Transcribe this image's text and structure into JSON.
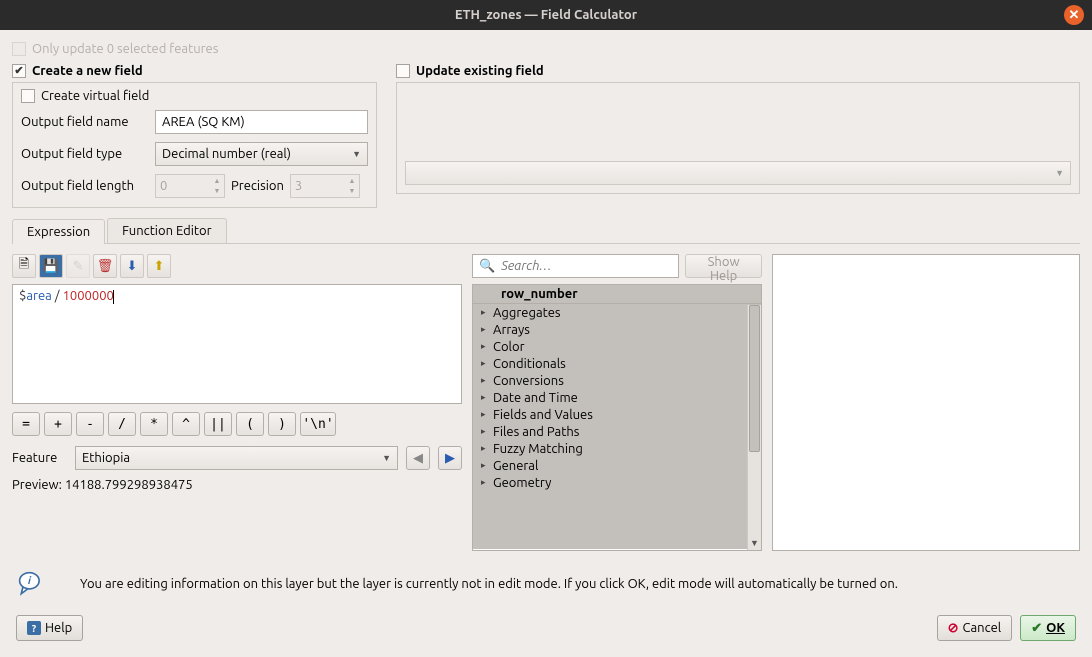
{
  "titlebar": {
    "title": "ETH_zones — Field Calculator"
  },
  "top": {
    "only_update_label": "Only update 0 selected features",
    "create_new_label": "Create a new field",
    "update_existing_label": "Update existing field",
    "create_virtual_label": "Create virtual field",
    "output_name_label": "Output field name",
    "output_name_value": "AREA (SQ KM)",
    "output_type_label": "Output field type",
    "output_type_value": "Decimal number (real)",
    "output_length_label": "Output field length",
    "output_length_value": "0",
    "precision_label": "Precision",
    "precision_value": "3"
  },
  "tabs": {
    "expression": "Expression",
    "function_editor": "Function Editor"
  },
  "toolbar_icons": {
    "new": "new-file-icon",
    "save": "save-icon",
    "edit": "edit-icon",
    "delete": "delete-icon",
    "import": "import-icon",
    "export": "export-icon"
  },
  "expression": {
    "prefix": "$",
    "var": "area",
    "op": " / ",
    "num": "1000000"
  },
  "operators": [
    "=",
    "+",
    "-",
    "/",
    "*",
    "^",
    "||",
    "(",
    ")",
    "'\\n'"
  ],
  "feature": {
    "label": "Feature",
    "value": "Ethiopia"
  },
  "preview": {
    "label": "Preview:",
    "value": "14188.799298938475"
  },
  "search": {
    "placeholder": "Search…",
    "show_help": "Show Help"
  },
  "tree": {
    "header": "row_number",
    "items": [
      "Aggregates",
      "Arrays",
      "Color",
      "Conditionals",
      "Conversions",
      "Date and Time",
      "Fields and Values",
      "Files and Paths",
      "Fuzzy Matching",
      "General",
      "Geometry"
    ]
  },
  "info": {
    "text": "You are editing information on this layer but the layer is currently not in edit mode. If you click OK, edit mode will automatically be turned on."
  },
  "footer": {
    "help": "Help",
    "cancel": "Cancel",
    "ok": "OK"
  }
}
